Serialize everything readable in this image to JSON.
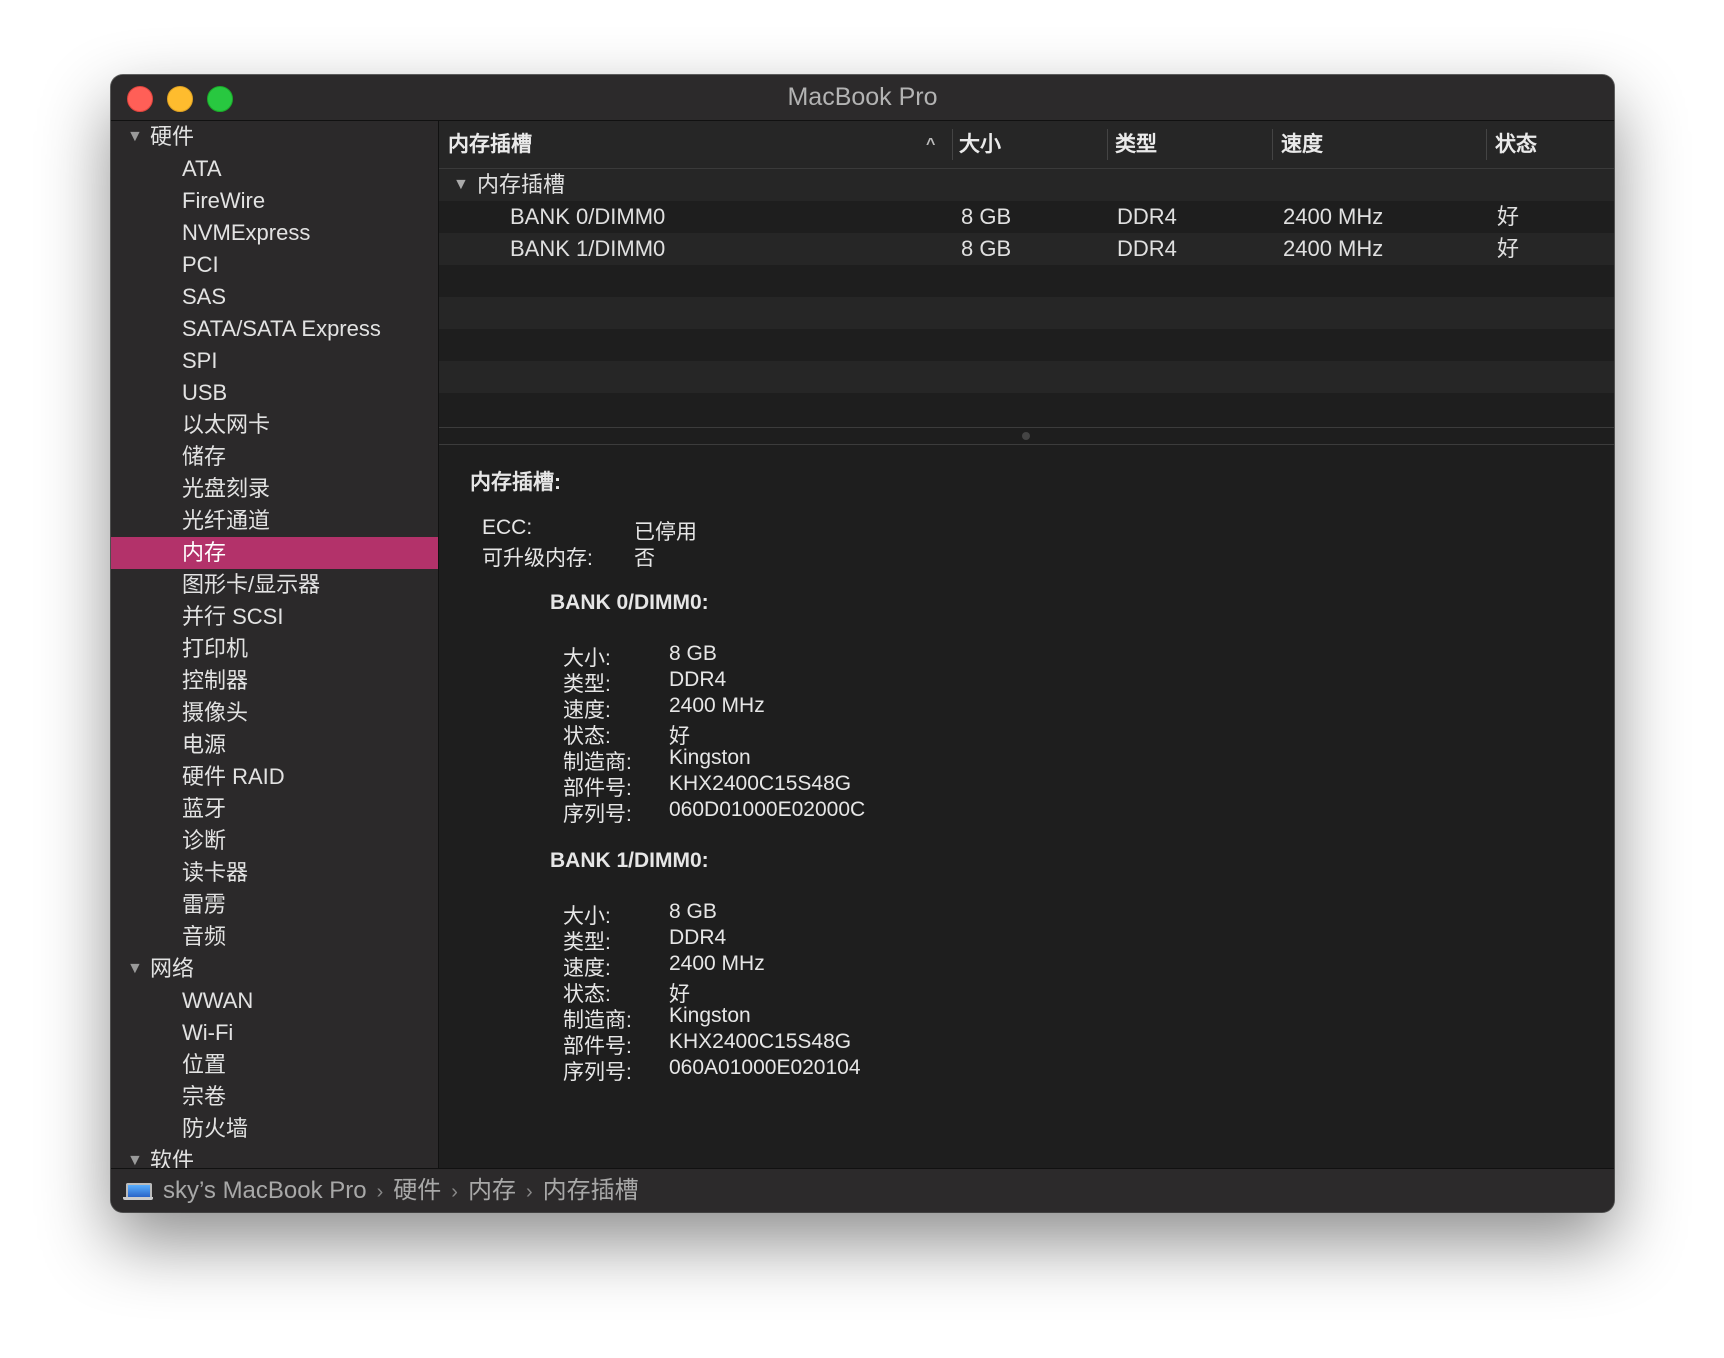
{
  "window": {
    "title": "MacBook Pro"
  },
  "colors": {
    "selection": "#b3326a",
    "close": "#ff5f57",
    "minimize": "#febc2e",
    "maximize": "#28c840"
  },
  "sidebar": {
    "groups": [
      {
        "label": "硬件",
        "items": [
          "ATA",
          "FireWire",
          "NVMExpress",
          "PCI",
          "SAS",
          "SATA/SATA Express",
          "SPI",
          "USB",
          "以太网卡",
          "储存",
          "光盘刻录",
          "光纤通道",
          "内存",
          "图形卡/显示器",
          "并行 SCSI",
          "打印机",
          "控制器",
          "摄像头",
          "电源",
          "硬件 RAID",
          "蓝牙",
          "诊断",
          "读卡器",
          "雷雳",
          "音频"
        ]
      },
      {
        "label": "网络",
        "items": [
          "WWAN",
          "Wi-Fi",
          "位置",
          "宗卷",
          "防火墙"
        ]
      },
      {
        "label": "软件",
        "items": []
      }
    ],
    "selected": "内存"
  },
  "table": {
    "headers": [
      "内存插槽",
      "大小",
      "类型",
      "速度",
      "状态"
    ],
    "group_label": "内存插槽",
    "rows": [
      [
        "BANK 0/DIMM0",
        "8 GB",
        "DDR4",
        "2400 MHz",
        "好"
      ],
      [
        "BANK 1/DIMM0",
        "8 GB",
        "DDR4",
        "2400 MHz",
        "好"
      ]
    ]
  },
  "detail": {
    "heading": "内存插槽:",
    "ecc_label": "ECC:",
    "ecc_value": "已停用",
    "upgradeable_label": "可升级内存:",
    "upgradeable_value": "否",
    "banks": [
      {
        "title": "BANK 0/DIMM0:",
        "fields": [
          {
            "label": "大小:",
            "value": "8 GB"
          },
          {
            "label": "类型:",
            "value": "DDR4"
          },
          {
            "label": "速度:",
            "value": "2400 MHz"
          },
          {
            "label": "状态:",
            "value": "好"
          },
          {
            "label": "制造商:",
            "value": "Kingston"
          },
          {
            "label": "部件号:",
            "value": "KHX2400C15S48G"
          },
          {
            "label": "序列号:",
            "value": "060D01000E02000C"
          }
        ]
      },
      {
        "title": "BANK 1/DIMM0:",
        "fields": [
          {
            "label": "大小:",
            "value": "8 GB"
          },
          {
            "label": "类型:",
            "value": "DDR4"
          },
          {
            "label": "速度:",
            "value": "2400 MHz"
          },
          {
            "label": "状态:",
            "value": "好"
          },
          {
            "label": "制造商:",
            "value": "Kingston"
          },
          {
            "label": "部件号:",
            "value": "KHX2400C15S48G"
          },
          {
            "label": "序列号:",
            "value": "060A01000E020104"
          }
        ]
      }
    ]
  },
  "statusbar": {
    "path": [
      "sky’s MacBook Pro",
      "硬件",
      "内存",
      "内存插槽"
    ],
    "icon": "laptop-icon"
  }
}
